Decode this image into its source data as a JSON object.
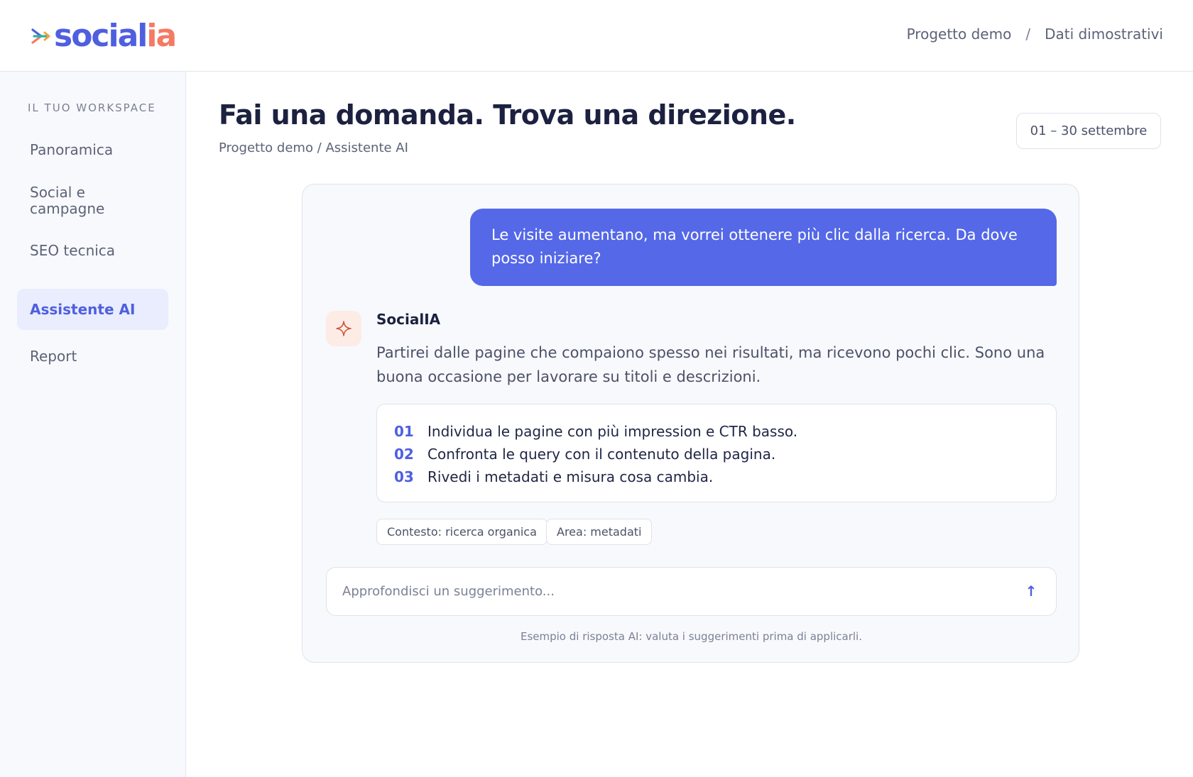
{
  "header": {
    "logo_part1": "social",
    "logo_part2": "ia",
    "nav": {
      "project": "Progetto demo",
      "separator": "/",
      "data": "Dati dimostrativi"
    }
  },
  "sidebar": {
    "workspace_label": "IL TUO WORKSPACE",
    "items": [
      {
        "label": "Panoramica",
        "active": false
      },
      {
        "label": "Social e campagne",
        "active": false
      },
      {
        "label": "SEO tecnica",
        "active": false
      },
      {
        "label": "Assistente AI",
        "active": true
      },
      {
        "label": "Report",
        "active": false
      }
    ]
  },
  "main": {
    "title": "Fai una domanda. Trova una direzione.",
    "breadcrumb": "Progetto demo / Assistente AI",
    "date_range": "01 – 30 settembre"
  },
  "chat": {
    "user_message": "Le visite aumentano, ma vorrei ottenere più clic dalla ricerca. Da dove posso iniziare?",
    "assistant": {
      "name": "SocialIA",
      "avatar_icon": "sparkle-icon",
      "message": "Partirei dalle pagine che compaiono spesso nei risultati, ma ricevono pochi clic. Sono una buona occasione per lavorare su titoli e descrizioni.",
      "steps": [
        {
          "num": "01",
          "text": "Individua le pagine con più impression e CTR basso."
        },
        {
          "num": "02",
          "text": "Confronta le query con il contenuto della pagina."
        },
        {
          "num": "03",
          "text": "Rivedi i metadati e misura cosa cambia."
        }
      ],
      "chips": [
        {
          "label": "Contesto: ricerca organica"
        },
        {
          "label": "Area: metadati"
        }
      ]
    },
    "input": {
      "placeholder": "Approfondisci un suggerimento...",
      "value": "",
      "send_icon": "arrow-up-icon"
    },
    "disclaimer": "Esempio di risposta AI: valuta i suggerimenti prima di applicarli."
  },
  "colors": {
    "accent": "#4f5fe0",
    "user_bubble": "#5468e8",
    "logo_secondary": "#f47a64",
    "active_nav_bg": "#e9edfd"
  }
}
